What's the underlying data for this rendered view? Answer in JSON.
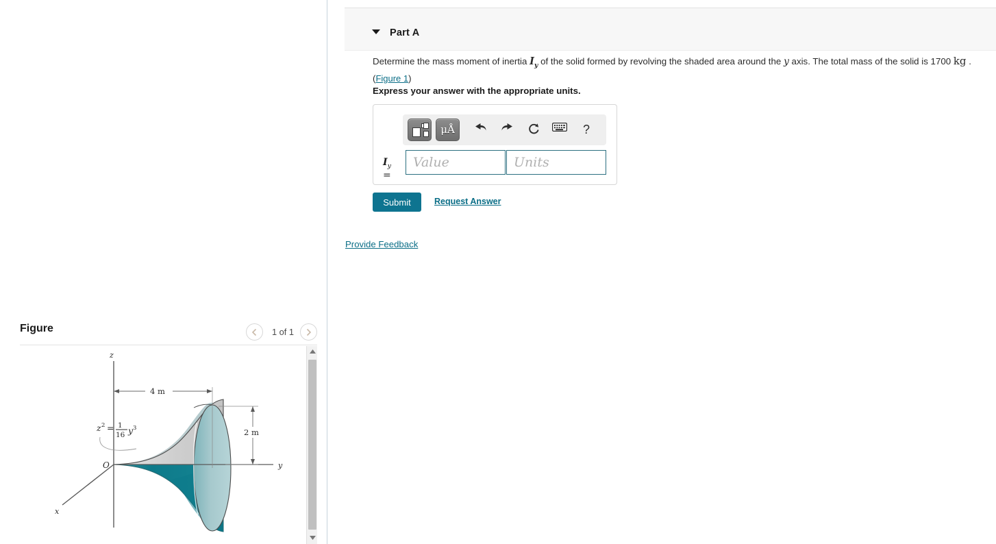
{
  "part": {
    "title": "Part A",
    "caret_icon": "caret-down-icon",
    "problem_prefix": "Determine the mass moment of inertia ",
    "problem_symbol": "I",
    "problem_symbol_sub": "y",
    "problem_mid": " of the solid formed by revolving the shaded area around the ",
    "problem_axis": "y",
    "problem_mid2": " axis. The total mass of the solid is ",
    "problem_mass": "1700",
    "problem_unit": "kg",
    "problem_suffix": ".",
    "figure_link": "(Figure 1)",
    "figure_link_text": "Figure 1",
    "express_units": "Express your answer with the appropriate units."
  },
  "toolbar": {
    "template_button_label": "",
    "template_button_name": "math-template-icon",
    "units_button_label": "μÅ",
    "undo_icon": "undo-icon",
    "redo_icon": "redo-icon",
    "reset_icon": "reset-icon",
    "keyboard_icon": "keyboard-icon",
    "help_icon": "help-icon",
    "help_label": "?"
  },
  "answer": {
    "label_symbol": "I",
    "label_sub": "y",
    "label_equals": "=",
    "value_placeholder": "Value",
    "value_text": "",
    "units_placeholder": "Units",
    "units_text": ""
  },
  "actions": {
    "submit_label": "Submit",
    "request_answer_label": "Request Answer",
    "provide_feedback_label": "Provide Feedback"
  },
  "figure": {
    "title": "Figure",
    "counter": "1 of 1",
    "prev_icon": "chevron-left-icon",
    "next_icon": "chevron-right-icon",
    "scroll_up_icon": "scroll-up-arrow-icon",
    "scroll_down_icon": "scroll-down-arrow-icon",
    "axis_z": "z",
    "axis_y": "y",
    "axis_x": "x",
    "origin": "O",
    "dim_horizontal": "4 m",
    "dim_vertical": "2 m",
    "equation_lhs": "z",
    "equation_lhs_exp": "2",
    "equation_eq": "=",
    "equation_num": "1",
    "equation_den": "16",
    "equation_rhs": "y",
    "equation_rhs_exp": "3"
  },
  "colors": {
    "accent_teal": "#0e7490",
    "link_teal": "#0b6e87",
    "solid_light_teal": "#9ec6ca",
    "solid_dark_teal": "#0d7a8a",
    "solid_gray": "#cfcfcf",
    "header_bg": "#f7f7f7",
    "field_border": "#2b6f80"
  }
}
